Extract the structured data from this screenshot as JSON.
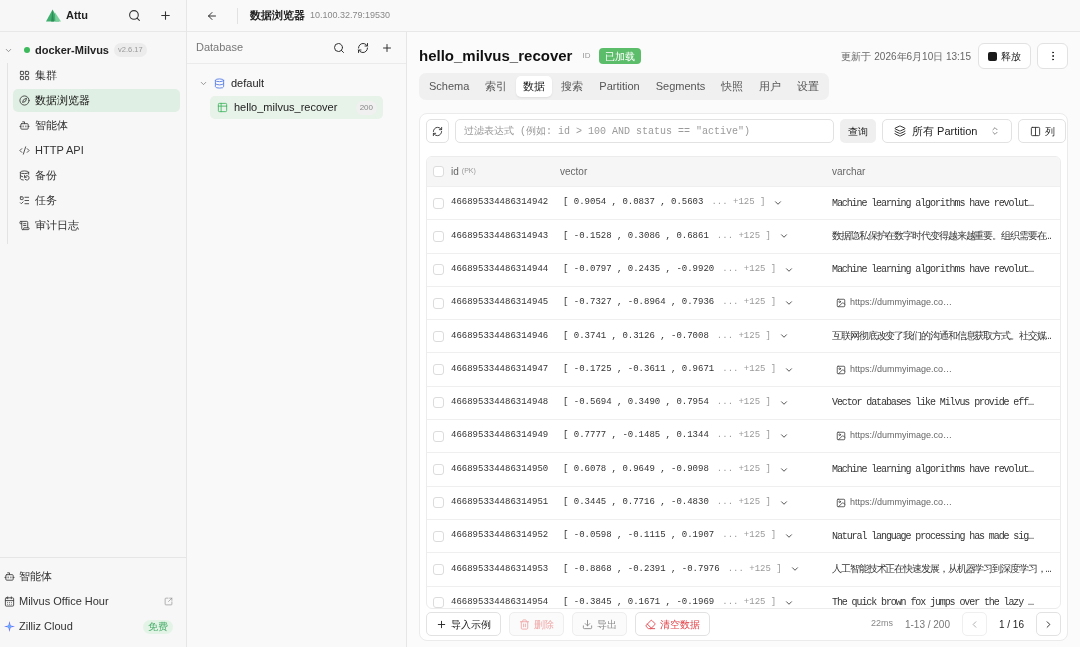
{
  "sidebar": {
    "app_name": "Attu",
    "connection": {
      "name": "docker-Milvus",
      "version": "v2.6.17",
      "connected": true,
      "expanded": true
    },
    "nav": [
      {
        "label": "集群",
        "selected": false
      },
      {
        "label": "数据浏览器",
        "selected": true
      },
      {
        "label": "智能体",
        "selected": false
      },
      {
        "label": "HTTP API",
        "selected": false
      },
      {
        "label": "备份",
        "selected": false
      },
      {
        "label": "任务",
        "selected": false
      },
      {
        "label": "审计日志",
        "selected": false
      }
    ],
    "bottom_links": [
      {
        "label": "智能体",
        "external": false
      },
      {
        "label": "Milvus Office Hour",
        "external": true
      },
      {
        "label": "Zilliz Cloud",
        "external": false,
        "badge": "免费"
      }
    ]
  },
  "top_bar": {
    "title": "数据浏览器",
    "address": "10.100.32.79:19530"
  },
  "database_panel": {
    "title": "Database",
    "tree": [
      {
        "label": "default",
        "expanded": true,
        "children": [
          {
            "label": "hello_milvus_recover",
            "count": "200",
            "selected": true
          }
        ]
      }
    ]
  },
  "collection": {
    "name": "hello_milvus_recover",
    "id_label": "ID",
    "status": {
      "label": "已加载",
      "loaded": true
    },
    "updated": "更新于 2026年6月10日 13:15",
    "release_button": "释放",
    "tabs": [
      {
        "label": "Schema",
        "selected": false
      },
      {
        "label": "索引",
        "selected": false
      },
      {
        "label": "数据",
        "selected": true
      },
      {
        "label": "搜索",
        "selected": false
      },
      {
        "label": "Partition",
        "selected": false
      },
      {
        "label": "Segments",
        "selected": false
      },
      {
        "label": "快照",
        "selected": false
      },
      {
        "label": "用户",
        "selected": false
      },
      {
        "label": "设置",
        "selected": false
      }
    ]
  },
  "toolbar": {
    "filter": {
      "placeholder": "过滤表达式 (例如: id > 100 AND status == \"active\")"
    },
    "query_button": "查询",
    "partition_select": "所有 Partition",
    "columns_button": "列"
  },
  "table": {
    "header_checkbox": {
      "checked": false
    },
    "columns": [
      {
        "label": "id",
        "tag": "(PK)"
      },
      {
        "label": "vector"
      },
      {
        "label": "varchar"
      }
    ],
    "rows": [
      {
        "checked": false,
        "id": "466895334486314942",
        "vector": {
          "values": "[ 0.9054 , 0.0837 , 0.5603",
          "more": "... +125 ]"
        },
        "varchar": {
          "kind": "text",
          "text": "Machine learning algorithms have revolut…"
        }
      },
      {
        "checked": false,
        "id": "466895334486314943",
        "vector": {
          "values": "[ -0.1528 , 0.3086 , 0.6861",
          "more": "... +125 ]"
        },
        "varchar": {
          "kind": "text",
          "text": "数据隐私保护在数字时代变得越来越重要。组织需要在…"
        }
      },
      {
        "checked": false,
        "id": "466895334486314944",
        "vector": {
          "values": "[ -0.0797 , 0.2435 , -0.9920",
          "more": "... +125 ]"
        },
        "varchar": {
          "kind": "text",
          "text": "Machine learning algorithms have revolut…"
        }
      },
      {
        "checked": false,
        "id": "466895334486314945",
        "vector": {
          "values": "[ -0.7327 , -0.8964 , 0.7936",
          "more": "... +125 ]"
        },
        "varchar": {
          "kind": "image",
          "text": "https://dummyimage.co…"
        }
      },
      {
        "checked": false,
        "id": "466895334486314946",
        "vector": {
          "values": "[ 0.3741 , 0.3126 , -0.7008",
          "more": "... +125 ]"
        },
        "varchar": {
          "kind": "text",
          "text": "互联网彻底改变了我们的沟通和信息获取方式。社交媒…"
        }
      },
      {
        "checked": false,
        "id": "466895334486314947",
        "vector": {
          "values": "[ -0.1725 , -0.3611 , 0.9671",
          "more": "... +125 ]"
        },
        "varchar": {
          "kind": "image",
          "text": "https://dummyimage.co…"
        }
      },
      {
        "checked": false,
        "id": "466895334486314948",
        "vector": {
          "values": "[ -0.5694 , 0.3490 , 0.7954",
          "more": "... +125 ]"
        },
        "varchar": {
          "kind": "text",
          "text": "Vector databases like Milvus provide eff…"
        }
      },
      {
        "checked": false,
        "id": "466895334486314949",
        "vector": {
          "values": "[ 0.7777 , -0.1485 , 0.1344",
          "more": "... +125 ]"
        },
        "varchar": {
          "kind": "image",
          "text": "https://dummyimage.co…"
        }
      },
      {
        "checked": false,
        "id": "466895334486314950",
        "vector": {
          "values": "[ 0.6078 , 0.9649 , -0.9098",
          "more": "... +125 ]"
        },
        "varchar": {
          "kind": "text",
          "text": "Machine learning algorithms have revolut…"
        }
      },
      {
        "checked": false,
        "id": "466895334486314951",
        "vector": {
          "values": "[ 0.3445 , 0.7716 , -0.4830",
          "more": "... +125 ]"
        },
        "varchar": {
          "kind": "image",
          "text": "https://dummyimage.co…"
        }
      },
      {
        "checked": false,
        "id": "466895334486314952",
        "vector": {
          "values": "[ -0.0598 , -0.1115 , 0.1907",
          "more": "... +125 ]"
        },
        "varchar": {
          "kind": "text",
          "text": "Natural language processing has made sig…"
        }
      },
      {
        "checked": false,
        "id": "466895334486314953",
        "vector": {
          "values": "[ -0.8868 , -0.2391 , -0.7976",
          "more": "... +125 ]"
        },
        "varchar": {
          "kind": "text",
          "text": "人工智能技术正在快速发展，从机器学习到深度学习，…"
        }
      },
      {
        "checked": false,
        "id": "466895334486314954",
        "vector": {
          "values": "[ -0.3845 , 0.1671 , -0.1969",
          "more": "... +125 ]"
        },
        "varchar": {
          "kind": "text",
          "text": "The quick brown fox jumps over the lazy …"
        }
      }
    ]
  },
  "footer": {
    "buttons": [
      {
        "label": "导入示例",
        "kind": "default",
        "disabled": false
      },
      {
        "label": "删除",
        "kind": "danger",
        "disabled": true
      },
      {
        "label": "导出",
        "kind": "default",
        "disabled": true
      },
      {
        "label": "清空数据",
        "kind": "danger",
        "disabled": false
      }
    ],
    "latency": "22ms",
    "range": "1-13 / 200",
    "page": "1 / 16",
    "prev_disabled": true,
    "next_disabled": false
  }
}
